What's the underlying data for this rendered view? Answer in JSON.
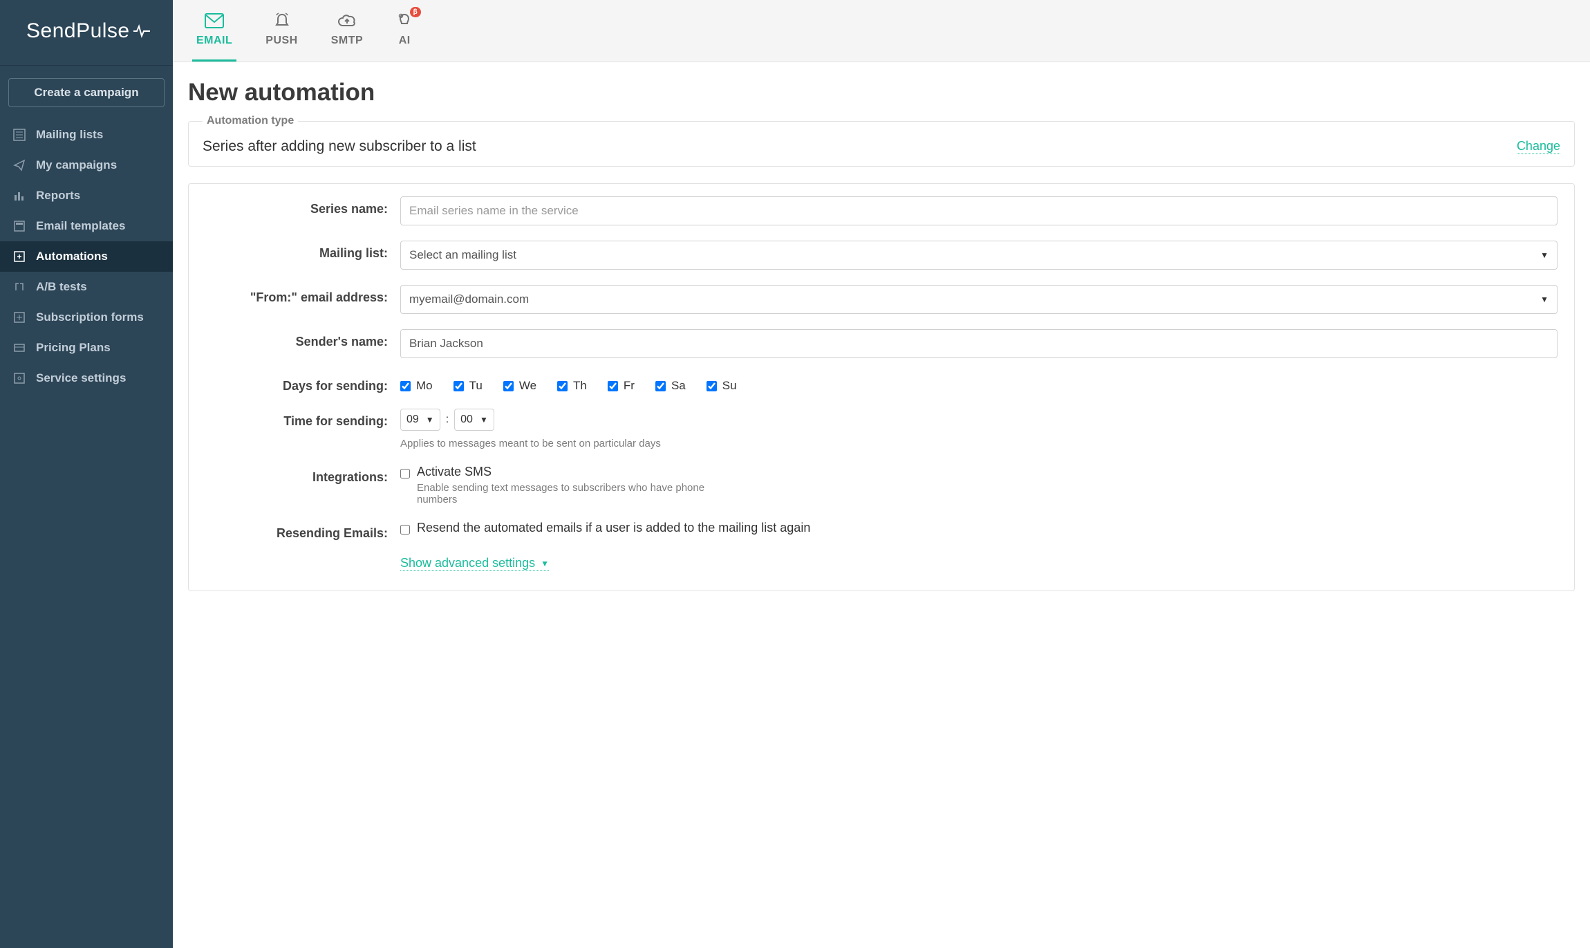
{
  "brand": "SendPulse",
  "create_campaign": "Create a campaign",
  "sidebar": {
    "items": [
      {
        "label": "Mailing lists"
      },
      {
        "label": "My campaigns"
      },
      {
        "label": "Reports"
      },
      {
        "label": "Email templates"
      },
      {
        "label": "Automations"
      },
      {
        "label": "A/B tests"
      },
      {
        "label": "Subscription forms"
      },
      {
        "label": "Pricing Plans"
      },
      {
        "label": "Service settings"
      }
    ]
  },
  "tabs": {
    "email": "EMAIL",
    "push": "PUSH",
    "smtp": "SMTP",
    "ai": "AI",
    "beta": "β"
  },
  "page_title": "New automation",
  "automation_type": {
    "legend": "Automation type",
    "value": "Series after adding new subscriber to a list",
    "change": "Change"
  },
  "form": {
    "series_name": {
      "label": "Series name:",
      "placeholder": "Email series name in the service"
    },
    "mailing_list": {
      "label": "Mailing list:",
      "value": "Select an mailing list"
    },
    "from_email": {
      "label": "\"From:\" email address:",
      "value": "myemail@domain.com"
    },
    "sender_name": {
      "label": "Sender's name:",
      "value": "Brian Jackson"
    },
    "days": {
      "label": "Days for sending:",
      "mo": "Mo",
      "tu": "Tu",
      "we": "We",
      "th": "Th",
      "fr": "Fr",
      "sa": "Sa",
      "su": "Su"
    },
    "time": {
      "label": "Time for sending:",
      "hour": "09",
      "minute": "00",
      "helper": "Applies to messages meant to be sent on particular days"
    },
    "integrations": {
      "label": "Integrations:",
      "text": "Activate SMS",
      "sub": "Enable sending text messages to subscribers who have phone numbers"
    },
    "resend": {
      "label": "Resending Emails:",
      "text": "Resend the automated emails if a user is added to the mailing list again"
    },
    "advanced": "Show advanced settings"
  }
}
